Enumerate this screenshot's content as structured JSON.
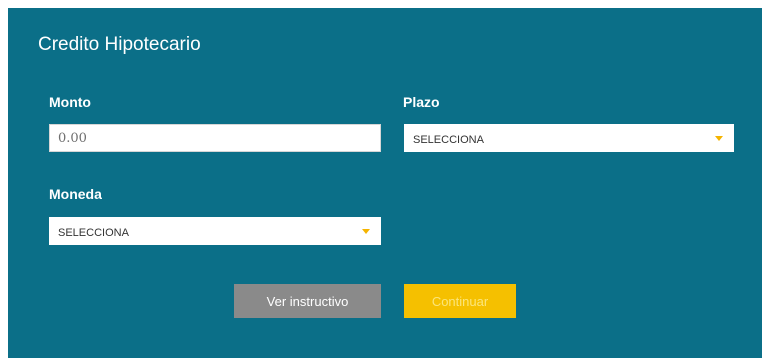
{
  "form": {
    "title": "Credito Hipotecario",
    "monto": {
      "label": "Monto",
      "placeholder": "0.00",
      "value": ""
    },
    "plazo": {
      "label": "Plazo",
      "selected": "SELECCIONA"
    },
    "moneda": {
      "label": "Moneda",
      "selected": "SELECCIONA"
    },
    "buttons": {
      "ver_instructivo": "Ver instructivo",
      "continuar": "Continuar"
    }
  },
  "colors": {
    "panel": "#0b6f88",
    "caret_accent": "#f5b400",
    "button_gray": "#8a8a8a",
    "button_yellow": "#f5c000"
  },
  "icons": {
    "dropdown": "chevron-down-icon"
  }
}
